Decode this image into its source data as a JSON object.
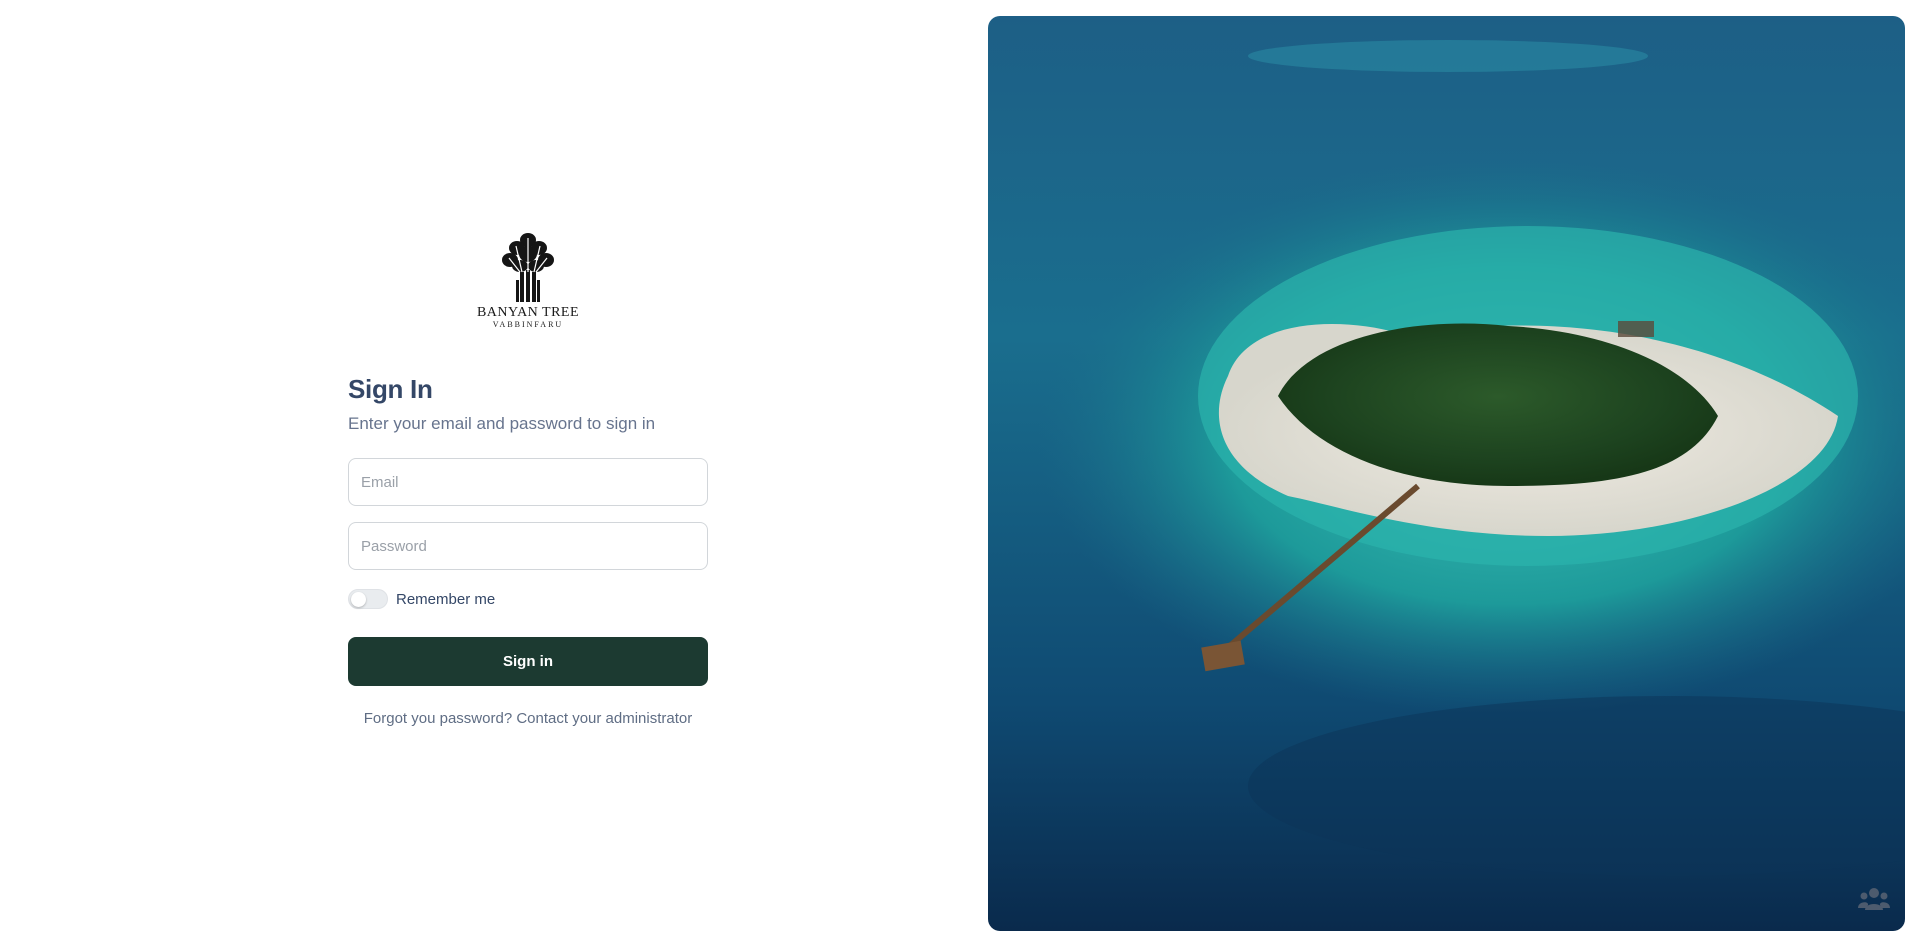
{
  "brand": {
    "name_line1": "BANYAN TREE",
    "name_line2": "VABBINFARU"
  },
  "login": {
    "title": "Sign In",
    "subtitle": "Enter your email and password to sign in",
    "email_placeholder": "Email",
    "email_value": "",
    "password_placeholder": "Password",
    "password_value": "",
    "remember_label": "Remember me",
    "remember_checked": false,
    "submit_label": "Sign in",
    "forgot_text": "Forgot you password? Contact your administrator"
  },
  "hero": {
    "image_icon": "island-aerial-photo",
    "colors": {
      "deep_ocean": "#0b2a4a",
      "lagoon": "#1fa39f",
      "sand": "#e9e2d6",
      "vegetation": "#1f4a22"
    }
  },
  "support": {
    "icon": "people-icon"
  },
  "colors": {
    "primary_button": "#1c3a31",
    "heading": "#344767",
    "muted": "#67748e"
  }
}
